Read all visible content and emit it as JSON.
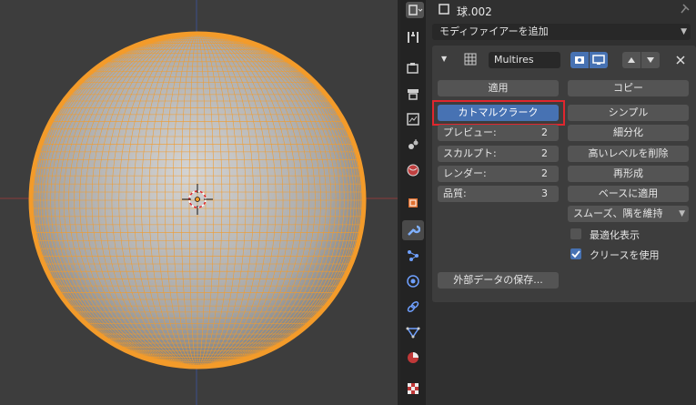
{
  "header": {
    "object_name": "球.002"
  },
  "add_modifier": "モディファイアーを追加",
  "modifier": {
    "name": "Multires",
    "apply": "適用",
    "copy": "コピー",
    "catmull_clark": "カトマルクラーク",
    "simple": "シンプル",
    "fields": [
      {
        "label": "プレビュー:",
        "value": "2"
      },
      {
        "label": "スカルプト:",
        "value": "2"
      },
      {
        "label": "レンダー:",
        "value": "2"
      },
      {
        "label": "品質:",
        "value": "3"
      }
    ],
    "subdivide": "細分化",
    "delete_higher": "高いレベルを削除",
    "reshape": "再形成",
    "apply_base": "ベースに適用",
    "uv_smooth": "スムーズ、隅を維持",
    "optimal_display": {
      "label": "最適化表示",
      "checked": false
    },
    "use_creases": {
      "label": "クリースを使用",
      "checked": true
    },
    "save_external": "外部データの保存..."
  },
  "colors": {
    "accent": "#4772b3",
    "wire": "#f39b2a",
    "highlight_box": "#e0262e"
  },
  "tabs": [
    "tool-icon",
    "render-icon",
    "output-icon",
    "view-layer-icon",
    "scene-icon",
    "world-icon",
    "object-icon",
    "modifier-icon",
    "particles-icon",
    "physics-icon",
    "constraints-icon",
    "data-icon",
    "material-icon",
    "texture-icon"
  ]
}
